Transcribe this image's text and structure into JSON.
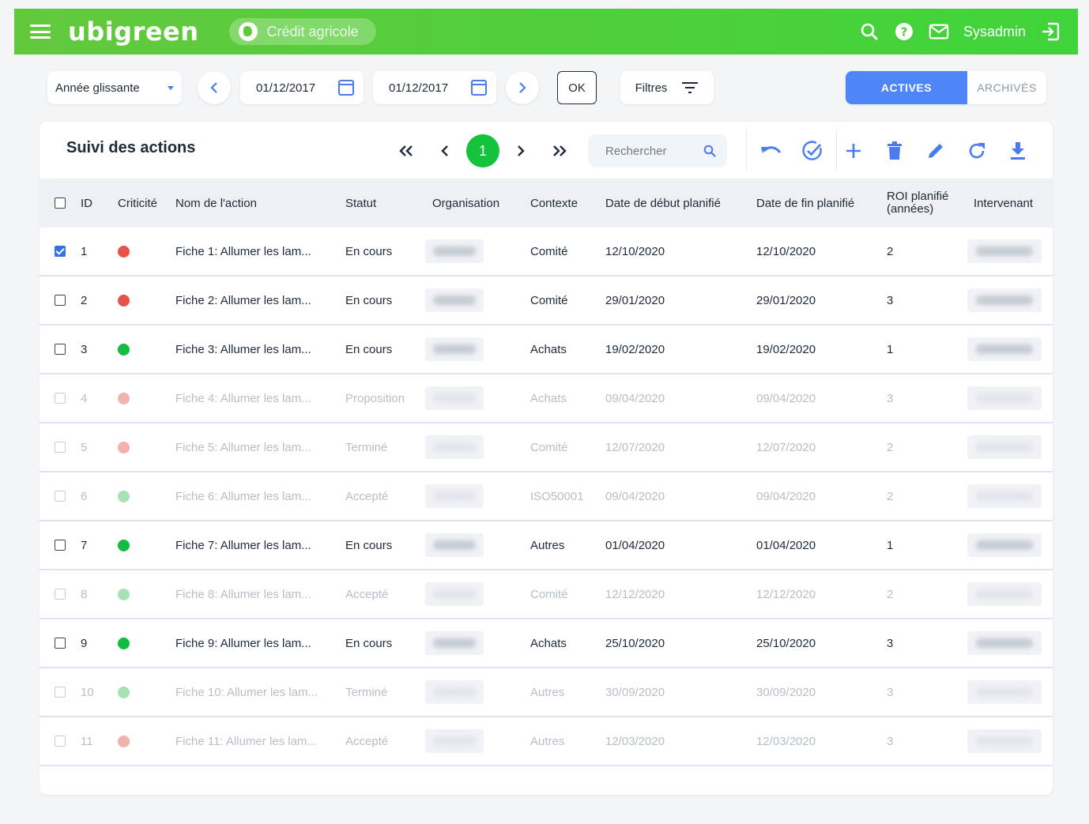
{
  "topbar": {
    "logo": "ubigreen",
    "organization": "Crédit agricole",
    "user": "Sysadmin",
    "brand_color": "#4ccf3b",
    "icons": [
      "menu-icon",
      "search-icon",
      "help-icon",
      "mail-icon",
      "logout-icon"
    ]
  },
  "filters": {
    "period_select": "Année glissante",
    "date_start": "01/12/2017",
    "date_end": "01/12/2017",
    "ok_label": "OK",
    "filters_label": "Filtres",
    "tab_active": "ACTIVES",
    "tab_archived": "ARCHIVÉS"
  },
  "card": {
    "title": "Suivi des actions",
    "current_page": "1",
    "search_placeholder": "Rechercher",
    "accent_color": "#4f86f7",
    "page_color": "#13c33b"
  },
  "columns": {
    "id": "ID",
    "criticite": "Criticité",
    "nom": "Nom de l'action",
    "statut": "Statut",
    "organisation": "Organisation",
    "contexte": "Contexte",
    "date_debut": "Date de début planifié",
    "date_fin": "Date de fin planifié",
    "roi_line1": "ROI planifié",
    "roi_line2": "(années)",
    "intervenant": "Intervenant"
  },
  "colors": {
    "red": "#e8524c",
    "green": "#14bb43",
    "red_dim": "#f3b1ae",
    "green_dim": "#a6e2b3"
  },
  "rows": [
    {
      "id": "1",
      "crit": "red",
      "nom": "Fiche 1: Allumer les lam...",
      "statut": "En cours",
      "contexte": "Comité",
      "debut": "12/10/2020",
      "fin": "12/10/2020",
      "roi": "2",
      "checked": true,
      "dim": false
    },
    {
      "id": "2",
      "crit": "red",
      "nom": "Fiche 2: Allumer les lam...",
      "statut": "En cours",
      "contexte": "Comité",
      "debut": "29/01/2020",
      "fin": "29/01/2020",
      "roi": "3",
      "checked": false,
      "dim": false
    },
    {
      "id": "3",
      "crit": "green",
      "nom": "Fiche 3: Allumer les lam...",
      "statut": "En cours",
      "contexte": "Achats",
      "debut": "19/02/2020",
      "fin": "19/02/2020",
      "roi": "1",
      "checked": false,
      "dim": false
    },
    {
      "id": "4",
      "crit": "red",
      "nom": "Fiche 4: Allumer les lam...",
      "statut": "Proposition",
      "contexte": "Achats",
      "debut": "09/04/2020",
      "fin": "09/04/2020",
      "roi": "3",
      "checked": false,
      "dim": true
    },
    {
      "id": "5",
      "crit": "red",
      "nom": "Fiche 5: Allumer les lam...",
      "statut": "Terminé",
      "contexte": "Comité",
      "debut": "12/07/2020",
      "fin": "12/07/2020",
      "roi": "2",
      "checked": false,
      "dim": true
    },
    {
      "id": "6",
      "crit": "green",
      "nom": "Fiche 6: Allumer les lam...",
      "statut": "Accepté",
      "contexte": "ISO50001",
      "debut": "09/04/2020",
      "fin": "09/04/2020",
      "roi": "2",
      "checked": false,
      "dim": true
    },
    {
      "id": "7",
      "crit": "green",
      "nom": "Fiche 7: Allumer les lam...",
      "statut": "En cours",
      "contexte": "Autres",
      "debut": "01/04/2020",
      "fin": "01/04/2020",
      "roi": "1",
      "checked": false,
      "dim": false
    },
    {
      "id": "8",
      "crit": "green",
      "nom": "Fiche 8: Allumer les lam...",
      "statut": "Accepté",
      "contexte": "Comité",
      "debut": "12/12/2020",
      "fin": "12/12/2020",
      "roi": "2",
      "checked": false,
      "dim": true
    },
    {
      "id": "9",
      "crit": "green",
      "nom": "Fiche 9: Allumer les lam...",
      "statut": "En cours",
      "contexte": "Achats",
      "debut": "25/10/2020",
      "fin": "25/10/2020",
      "roi": "3",
      "checked": false,
      "dim": false
    },
    {
      "id": "10",
      "crit": "green",
      "nom": "Fiche 10: Allumer les lam...",
      "statut": "Terminé",
      "contexte": "Autres",
      "debut": "30/09/2020",
      "fin": "30/09/2020",
      "roi": "3",
      "checked": false,
      "dim": true
    },
    {
      "id": "11",
      "crit": "red",
      "nom": "Fiche 11: Allumer les lam...",
      "statut": "Accepté",
      "contexte": "Autres",
      "debut": "12/03/2020",
      "fin": "12/03/2020",
      "roi": "3",
      "checked": false,
      "dim": true
    }
  ]
}
